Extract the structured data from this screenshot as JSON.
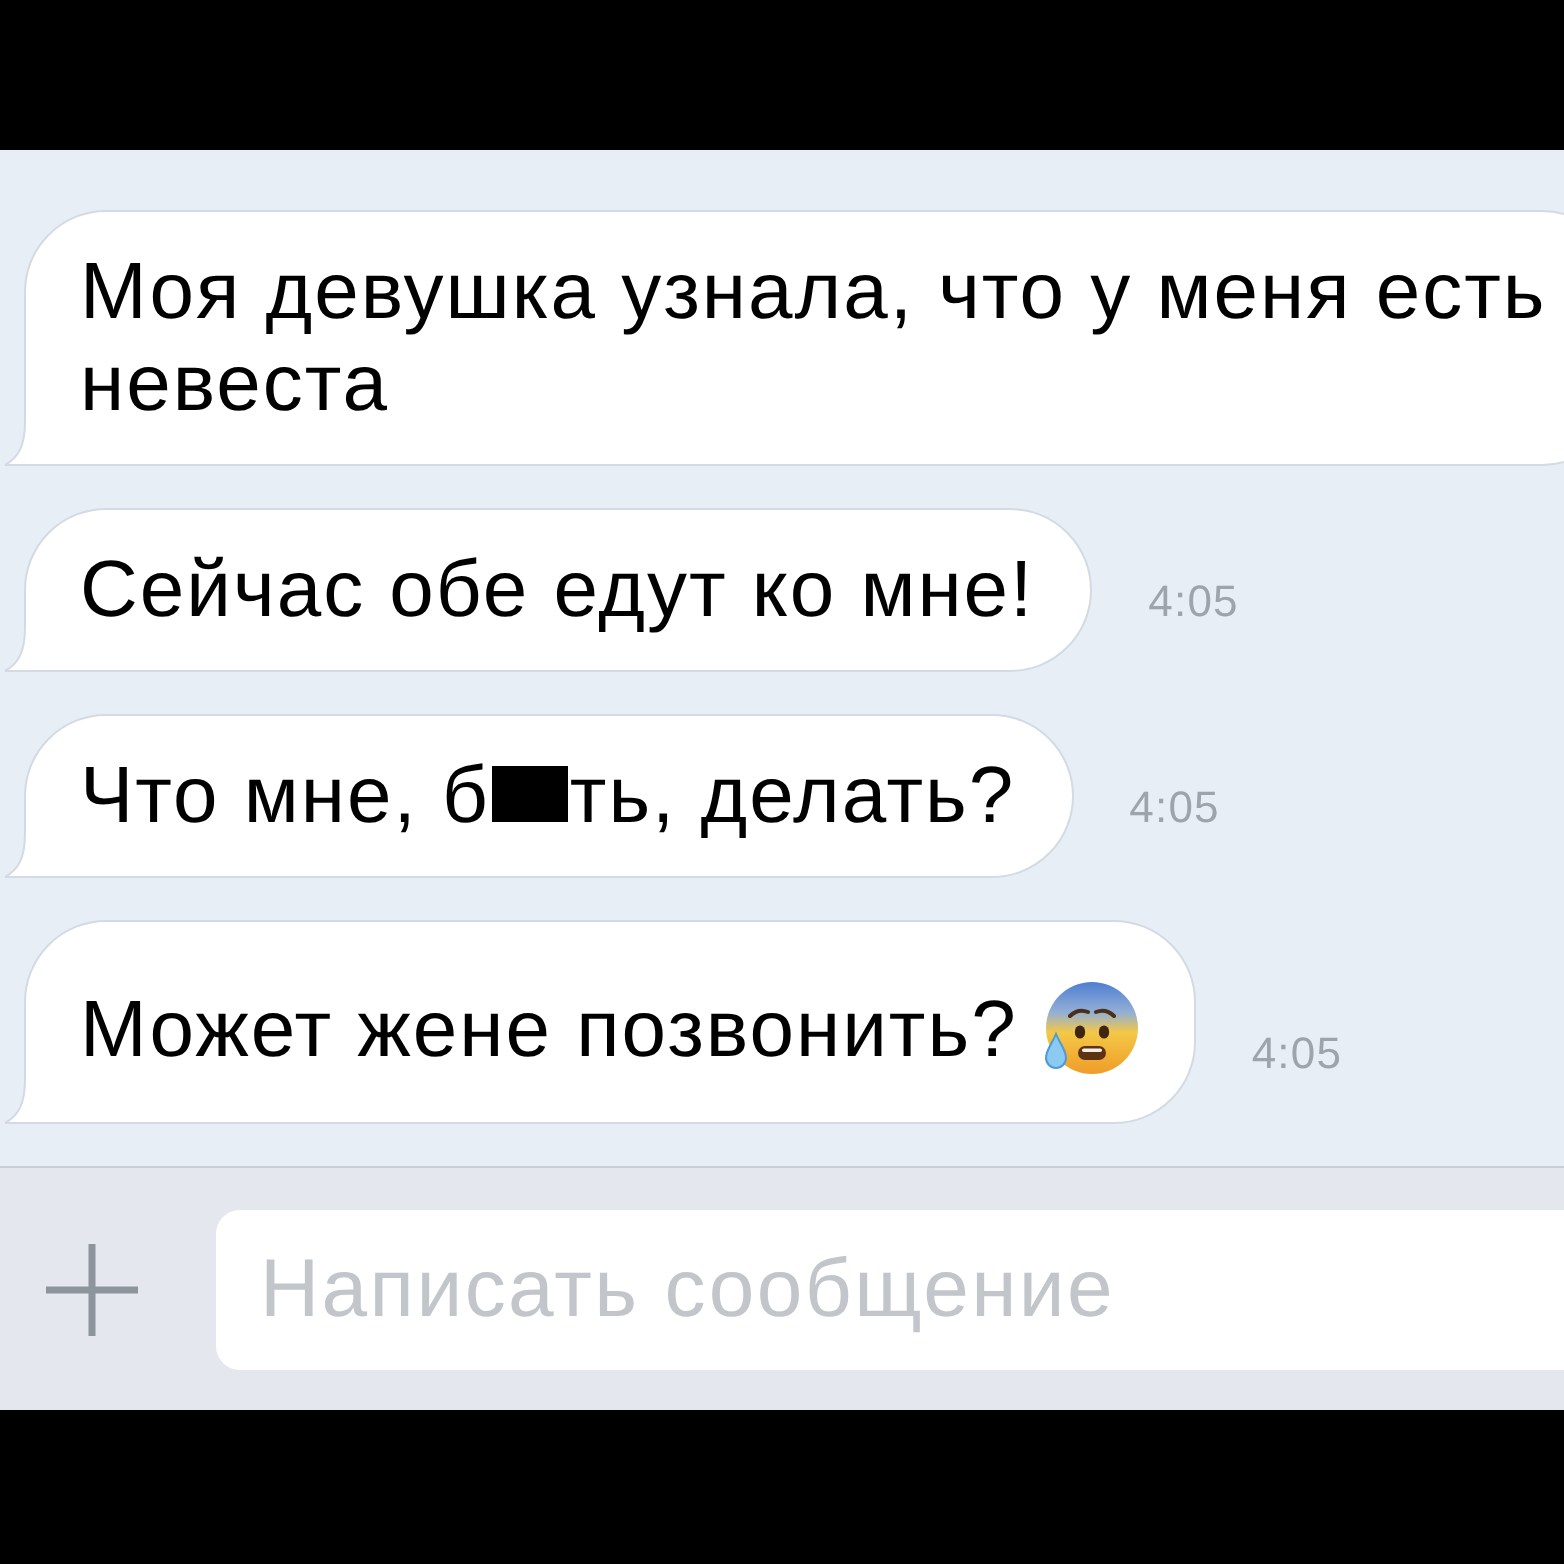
{
  "messages": [
    {
      "parts": [
        {
          "kind": "text",
          "text": "Моя девушка узнала, что у меня есть невеста"
        }
      ]
    },
    {
      "parts": [
        {
          "kind": "text",
          "text": "Сейчас обе едут ко мне!"
        }
      ],
      "time": "4:05"
    },
    {
      "parts": [
        {
          "kind": "text",
          "text": "Что мне, б"
        },
        {
          "kind": "redaction"
        },
        {
          "kind": "text",
          "text": "ть, делать?"
        }
      ],
      "time": "4:05"
    },
    {
      "parts": [
        {
          "kind": "text",
          "text": "Может жене позвонить?"
        },
        {
          "kind": "emoji"
        }
      ],
      "time": "4:05"
    }
  ],
  "composer": {
    "placeholder": "Написать сообщение"
  }
}
